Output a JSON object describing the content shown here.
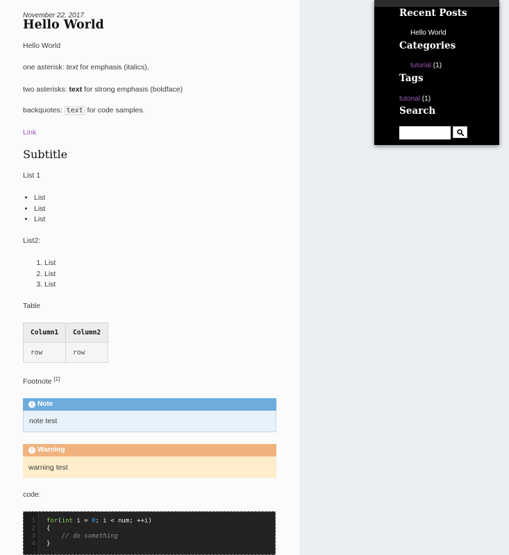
{
  "post": {
    "date": "November 22, 2017",
    "title": "Hello World",
    "intro": "Hello World",
    "italics": {
      "prefix": "one asterisk: ",
      "emph": "text",
      "suffix": " for emphasis (italics),"
    },
    "bold": {
      "prefix": "two asterisks: ",
      "strong": "text",
      "suffix": " for strong emphasis (boldface)"
    },
    "code": {
      "prefix": "backquotes: ",
      "code": "text",
      "suffix": " for code samples."
    },
    "link": "Link",
    "subtitle": "Subtitle",
    "list1_label": "List 1",
    "list1": [
      "List",
      "List",
      "List"
    ],
    "list2_label": "List2:",
    "list2": [
      "List",
      "List",
      "List"
    ],
    "table_label": "Table",
    "table": {
      "headers": [
        "Column1",
        "Column2"
      ],
      "rows": [
        [
          "row",
          "row"
        ]
      ]
    },
    "footnote": {
      "text": "Footnote ",
      "ref": "[1]"
    },
    "note": {
      "title": "Note",
      "icon": "exclamation-circle-icon",
      "body": "note test"
    },
    "warning": {
      "title": "Warning",
      "icon": "exclamation-circle-icon",
      "body": "warning test"
    },
    "code_label": "code:",
    "code_block": {
      "line_numbers": [
        "1",
        "2",
        "3",
        "4"
      ]
    }
  },
  "sidebar": {
    "recent_posts": {
      "title": "Recent Posts",
      "items": [
        "Hello World"
      ]
    },
    "categories": {
      "title": "Categories",
      "items": [
        {
          "label": "tutorial",
          "count": "(1)"
        }
      ]
    },
    "tags": {
      "title": "Tags",
      "items": [
        {
          "label": "tutorial",
          "count": "(1)"
        }
      ]
    },
    "search": {
      "title": "Search",
      "placeholder": "",
      "button_icon": "search-icon"
    }
  },
  "colors": {
    "link": "#9b59b6",
    "note_header": "#6eacde",
    "note_body": "#e7f2fa",
    "warning_header": "#f0b37e",
    "warning_body": "#ffedcc",
    "sidebar_bg": "#000000",
    "page_bg": "#eceff2"
  }
}
